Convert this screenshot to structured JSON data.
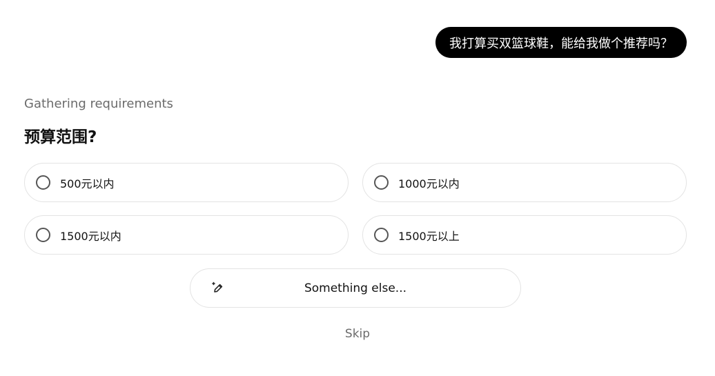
{
  "chat": {
    "user_message": "我打算买双篮球鞋，能给我做个推荐吗？"
  },
  "assistant": {
    "status": "Gathering requirements",
    "question": "预算范围?",
    "options": [
      {
        "label": "500元以内"
      },
      {
        "label": "1000元以内"
      },
      {
        "label": "1500元以内"
      },
      {
        "label": "1500元以上"
      }
    ],
    "something_else_label": "Something else...",
    "skip_label": "Skip"
  },
  "icons": {
    "pencil": "pencil-sparkle-icon",
    "radio": "radio-unchecked-icon"
  },
  "colors": {
    "bubble_bg": "#000000",
    "muted_text": "#6b6b6b",
    "border": "#e3e3e3"
  }
}
